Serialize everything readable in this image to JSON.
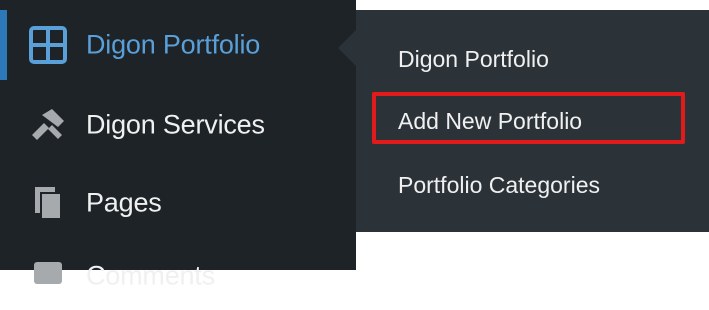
{
  "sidebar": {
    "items": [
      {
        "label": "Digon Portfolio",
        "icon": "grid-icon",
        "active": true
      },
      {
        "label": "Digon Services",
        "icon": "tools-icon"
      },
      {
        "label": "Pages",
        "icon": "pages-icon"
      },
      {
        "label": "Comments",
        "icon": "comments-icon"
      }
    ]
  },
  "submenu": {
    "items": [
      {
        "label": "Digon Portfolio"
      },
      {
        "label": "Add New Portfolio",
        "highlighted": true
      },
      {
        "label": "Portfolio Categories"
      }
    ]
  },
  "colors": {
    "sidebar_bg": "#1d2327",
    "submenu_bg": "#2c3338",
    "active_text": "#5a9fd8",
    "accent_bar": "#2c78b9",
    "highlight_border": "#e11b1b"
  }
}
